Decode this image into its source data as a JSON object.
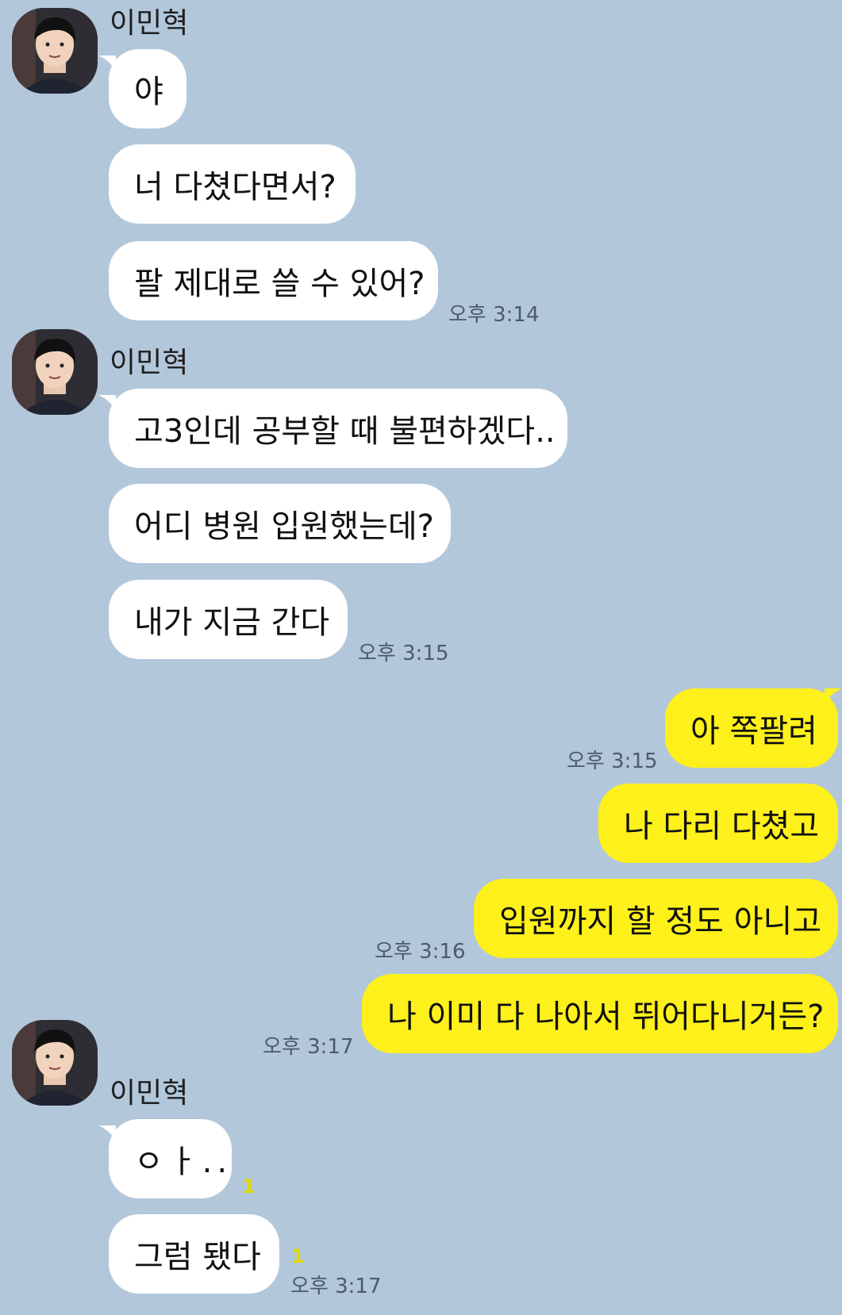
{
  "sender": {
    "name": "이민혁"
  },
  "colors": {
    "background": "#b2c7da",
    "incoming_bubble": "#ffffff",
    "outgoing_bubble": "#fef01b",
    "unread": "#e3d800"
  },
  "groups": [
    {
      "name": "이민혁",
      "messages": [
        "야",
        "너 다쳤다면서?",
        "팔 제대로 쓸 수 있어?"
      ],
      "time": "오후 3:14"
    },
    {
      "name": "이민혁",
      "messages": [
        "고3인데 공부할 때 불편하겠다..",
        "어디 병원 입원했는데?",
        "내가 지금 간다"
      ],
      "time": "오후 3:15"
    },
    {
      "name": "이민혁",
      "messages": [
        "ㅇㅏ..",
        "그럼 됐다"
      ],
      "unread": [
        "1",
        "1"
      ],
      "time": "오후 3:17"
    }
  ],
  "outgoing": [
    {
      "text": "아 쪽팔려",
      "time": "오후 3:15"
    },
    {
      "text": "나 다리 다쳤고"
    },
    {
      "text": "입원까지 할 정도 아니고",
      "time": "오후 3:16"
    },
    {
      "text": "나 이미 다 나아서 뛰어다니거든?",
      "time": "오후 3:17"
    }
  ]
}
